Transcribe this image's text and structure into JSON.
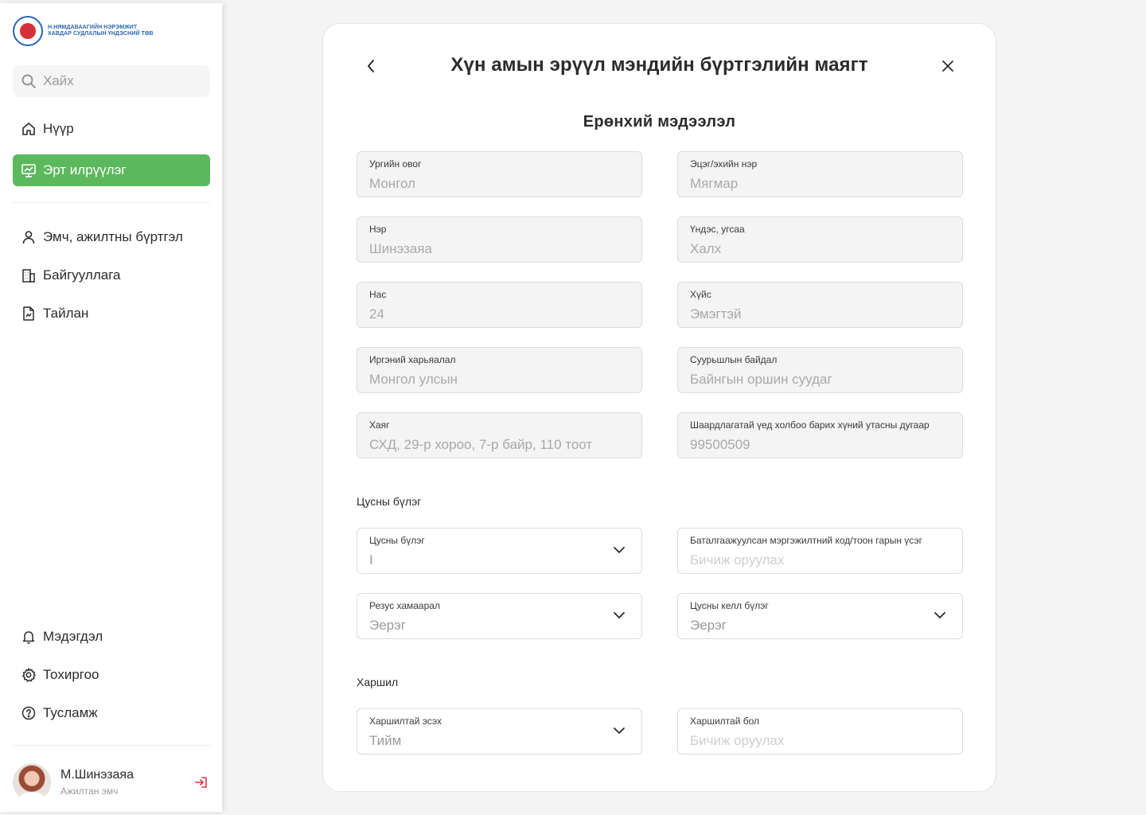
{
  "brand": {
    "line1": "Н.НЯМДАВААГИЙН НЭРЭМЖИТ",
    "line2": "ХАВДАР СУДЛАЛЫН ҮНДЭСНИЙ ТӨВ"
  },
  "search": {
    "placeholder": "Хайх"
  },
  "nav": {
    "home": "Нүүр",
    "screening": "Эрт илрүүлэг",
    "staff": "Эмч, ажилтны бүртгэл",
    "orgs": "Байгууллага",
    "report": "Тайлан",
    "notifications": "Мэдэгдэл",
    "settings": "Тохиргоо",
    "help": "Тусламж"
  },
  "user": {
    "name": "М.Шинэзаяа",
    "role": "Ажилтан эмч"
  },
  "form": {
    "title": "Хүн амын эрүүл мэндийн бүртгэлийн маягт",
    "section_general": "Ерөнхий мэдээлэл",
    "general": {
      "surname": {
        "label": "Ургийн овог",
        "value": "Монгол"
      },
      "parent_name": {
        "label": "Эцэг/эхийн нэр",
        "value": "Мягмар"
      },
      "name": {
        "label": "Нэр",
        "value": "Шинэзаяа"
      },
      "ethnicity": {
        "label": "Үндэс, угсаа",
        "value": "Халх"
      },
      "age": {
        "label": "Нас",
        "value": "24"
      },
      "gender": {
        "label": "Хүйс",
        "value": "Эмэгтэй"
      },
      "citizenship": {
        "label": "Иргэний харьяалал",
        "value": "Монгол улсын"
      },
      "residency": {
        "label": "Суурьшлын байдал",
        "value": "Байнгын оршин суудаг"
      },
      "address": {
        "label": "Хаяг",
        "value": "СХД, 29-р хороо, 7-р байр, 110 тоот"
      },
      "emergency_phone": {
        "label": "Шаардлагатай үед холбоо барих хүний утасны дугаар",
        "value": "99500509"
      }
    },
    "section_blood": "Цусны бүлэг",
    "blood": {
      "group": {
        "label": "Цусны бүлэг",
        "value": "I"
      },
      "verified_code": {
        "label": "Баталгаажуулсан мэргэжилтний код/тоон гарын үсэг",
        "placeholder": "Бичиж оруулах"
      },
      "rhesus": {
        "label": "Резус хамаарал",
        "value": "Эерэг"
      },
      "kell": {
        "label": "Цусны келл бүлэг",
        "value": "Эерэг"
      }
    },
    "section_allergy": "Харшил",
    "allergy": {
      "has_allergy": {
        "label": "Харшилтай эсэх",
        "value": "Тийм"
      },
      "if_allergic": {
        "label": "Харшилтай бол",
        "placeholder": "Бичиж оруулах"
      }
    }
  },
  "colors": {
    "accent": "#5cb85c",
    "logout": "#d9343f",
    "brand_blue": "#2a66b3"
  }
}
